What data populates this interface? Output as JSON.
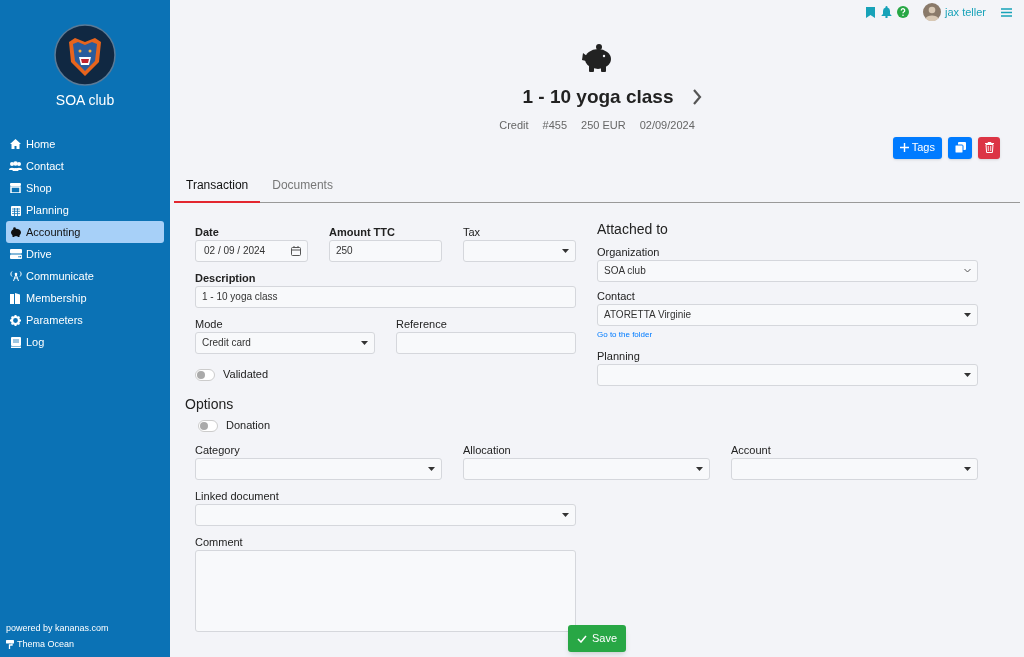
{
  "sidebar": {
    "club_name": "SOA club",
    "nav": [
      {
        "label": "Home",
        "selected": false
      },
      {
        "label": "Contact",
        "selected": false
      },
      {
        "label": "Shop",
        "selected": false
      },
      {
        "label": "Planning",
        "selected": false
      },
      {
        "label": "Accounting",
        "selected": true
      },
      {
        "label": "Drive",
        "selected": false
      },
      {
        "label": "Communicate",
        "selected": false
      },
      {
        "label": "Membership",
        "selected": false
      },
      {
        "label": "Parameters",
        "selected": false
      },
      {
        "label": "Log",
        "selected": false
      }
    ],
    "powered_by": "powered by kananas.com",
    "theme": "Thema Ocean"
  },
  "topbar": {
    "user_name": "jax teller"
  },
  "header": {
    "title": "1 - 10 yoga class",
    "meta": [
      "Credit",
      "#455",
      "250 EUR",
      "02/09/2024"
    ]
  },
  "actions": {
    "tags_label": "Tags"
  },
  "tabs": [
    {
      "label": "Transaction",
      "selected": true
    },
    {
      "label": "Documents",
      "selected": false
    }
  ],
  "transaction": {
    "rows": [
      [
        {
          "kind": "date",
          "label": "Date",
          "bold": true,
          "value": "02 / 09 / 2024"
        },
        {
          "kind": "text",
          "label": "Amount TTC",
          "bold": true,
          "value": "250"
        },
        {
          "kind": "select",
          "label": "Tax",
          "bold": false
        }
      ],
      [
        {
          "kind": "text",
          "label": "Description",
          "bold": true,
          "value": "1 - 10 yoga class"
        }
      ],
      [
        {
          "kind": "select",
          "label": "Mode",
          "bold": false,
          "value": "Credit card"
        },
        {
          "kind": "text",
          "label": "Reference",
          "bold": false
        }
      ],
      [
        {
          "kind": "toggle",
          "label": "Validated",
          "on": false
        }
      ]
    ]
  },
  "attached_to": {
    "title": "Attached to",
    "fields": [
      {
        "kind": "native-select",
        "label": "Organization",
        "value": "SOA club"
      },
      {
        "kind": "select",
        "label": "Contact",
        "value": "ATORETTA Virginie",
        "link": "Go to the folder"
      },
      {
        "kind": "select",
        "label": "Planning"
      }
    ]
  },
  "options": {
    "title": "Options",
    "rows": [
      [
        {
          "kind": "toggle",
          "label": "Donation",
          "on": false
        }
      ],
      [
        {
          "kind": "select",
          "label": "Category",
          "bold": false
        },
        {
          "kind": "select",
          "label": "Allocation",
          "bold": false
        },
        {
          "kind": "select",
          "label": "Account",
          "bold": false
        }
      ],
      [
        {
          "kind": "select",
          "label": "Linked document",
          "bold": false,
          "half": true
        }
      ],
      [
        {
          "kind": "textarea",
          "label": "Comment",
          "bold": false,
          "half": true
        }
      ]
    ]
  },
  "save_label": "Save"
}
